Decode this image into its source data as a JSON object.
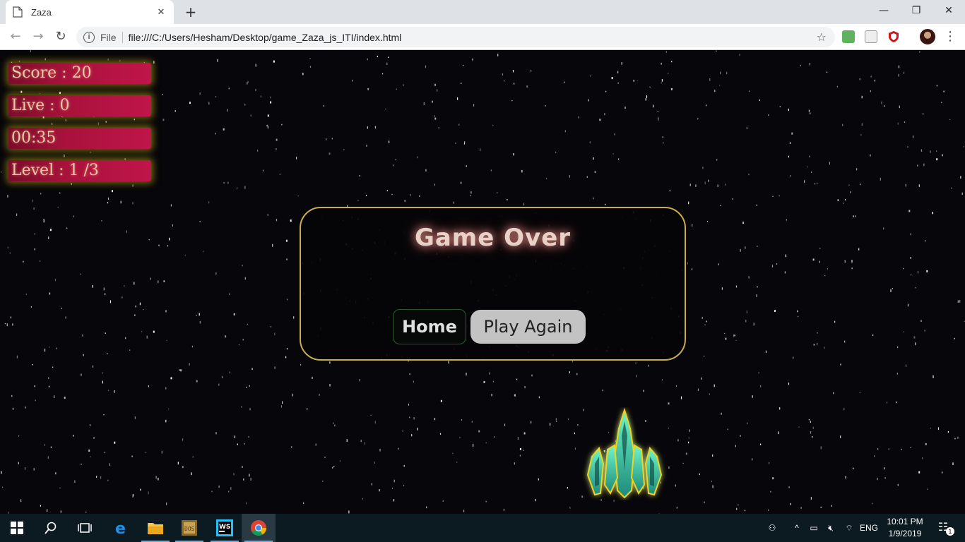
{
  "browser": {
    "tab_title": "Zaza",
    "new_tab": "+",
    "scheme_label": "File",
    "url": "file:///C:/Users/Hesham/Desktop/game_Zaza_js_ITI/index.html",
    "window_controls": {
      "minimize": "—",
      "restore": "❐",
      "close": "✕"
    }
  },
  "hud": {
    "score": "Score : 20",
    "live": "Live : 0",
    "timer": "00:35",
    "level": "Level : 1 /3"
  },
  "modal": {
    "title": "Game Over",
    "home_button": "Home",
    "play_again_button": "Play Again"
  },
  "taskbar": {
    "language": "ENG",
    "time": "10:01 PM",
    "date": "1/9/2019",
    "notification_count": "1",
    "apps": [
      "start",
      "search",
      "task-view",
      "edge",
      "file-explorer",
      "dosbox",
      "webstorm",
      "chrome"
    ]
  },
  "colors": {
    "hud_bar": "#a8123c",
    "hud_glow": "#aa9614",
    "modal_border": "#c9ad4a",
    "play_again_bg": "#c3c3c3",
    "taskbar": "#0c1a22"
  }
}
